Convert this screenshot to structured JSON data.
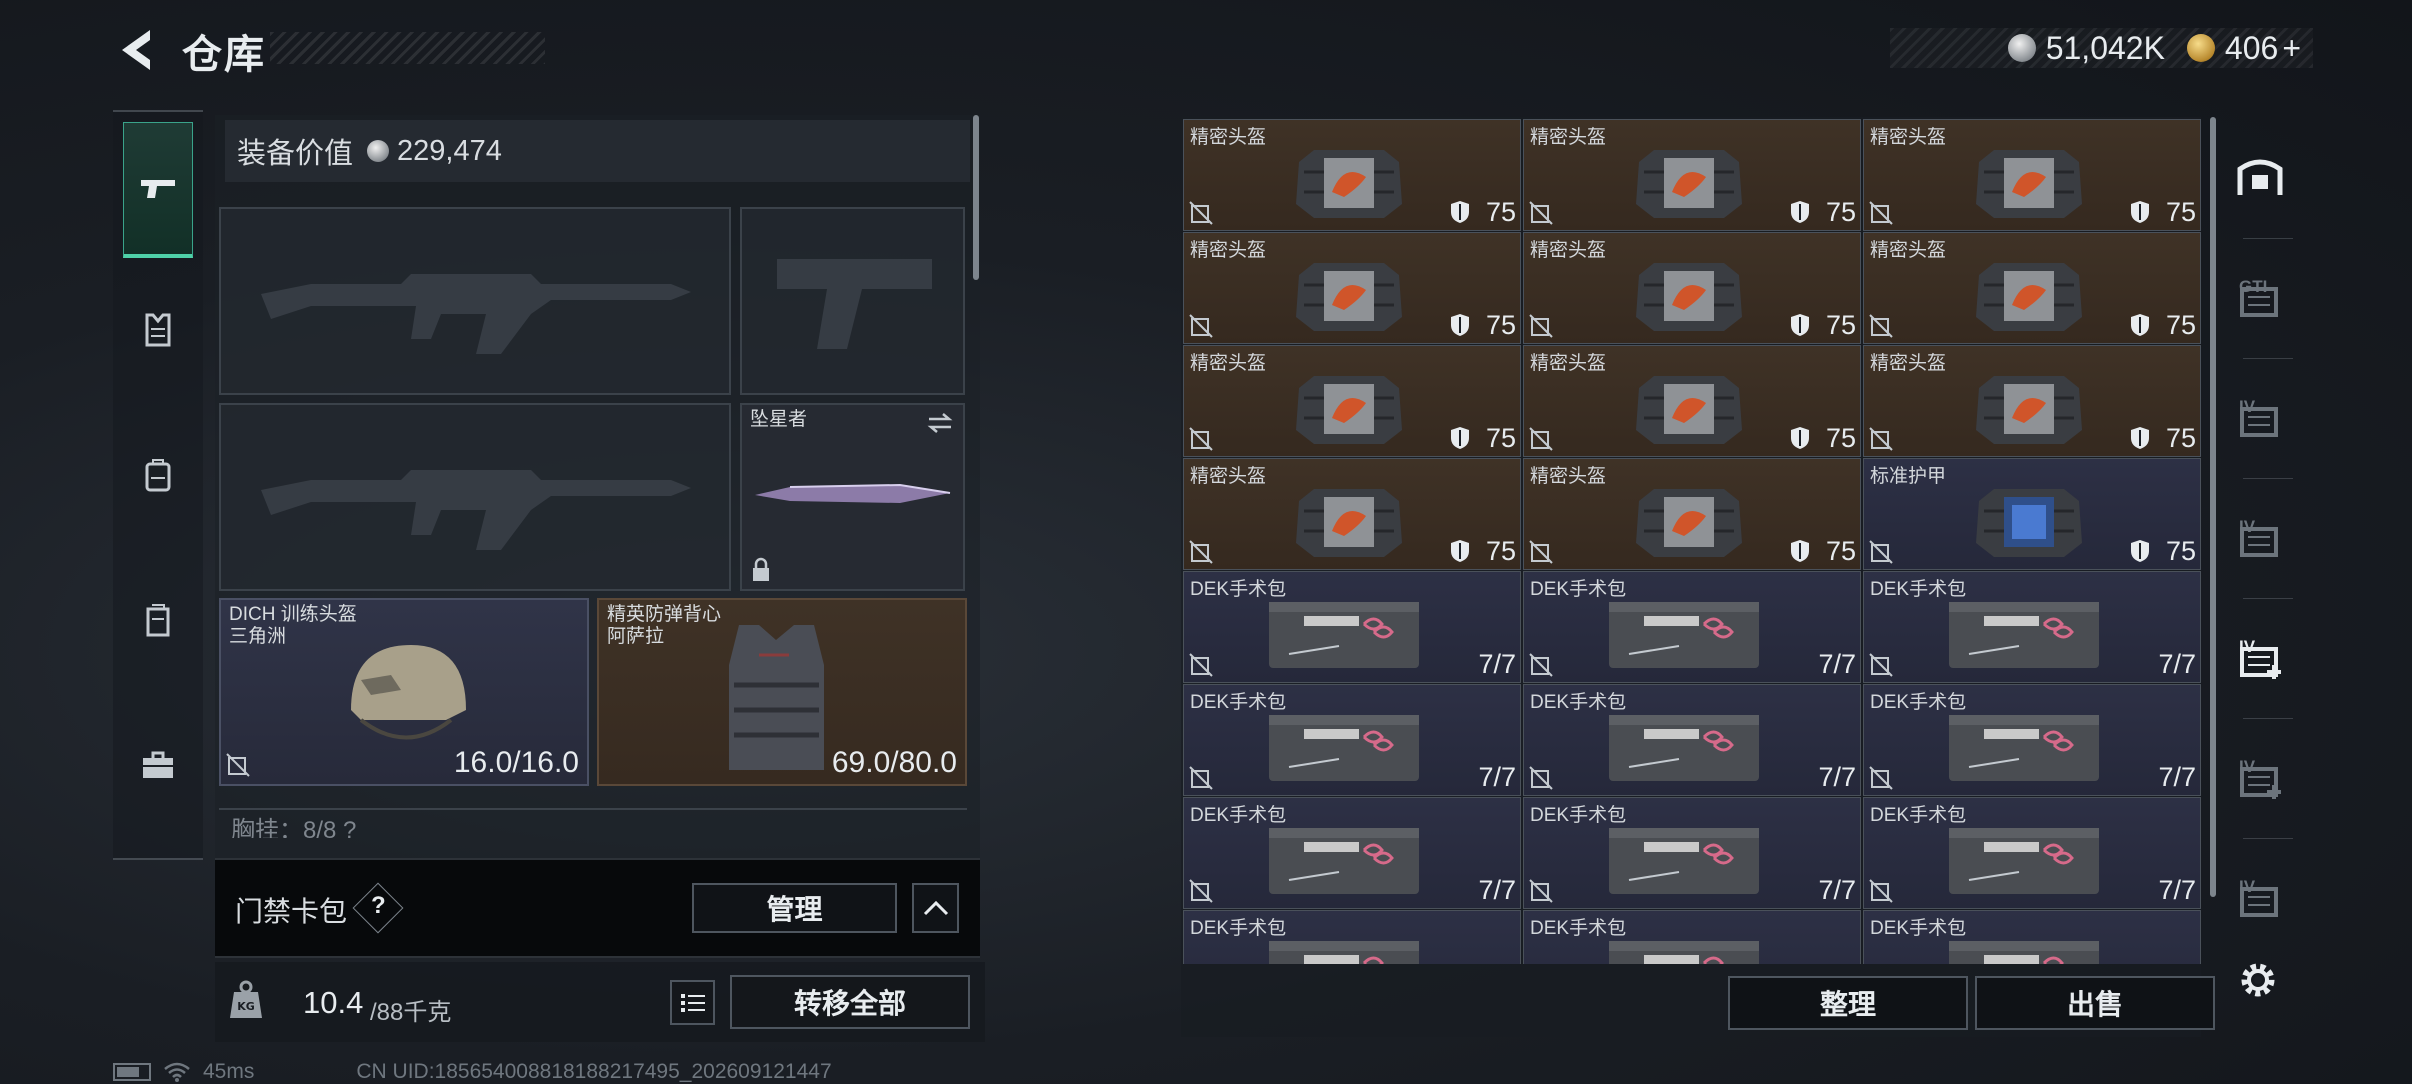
{
  "header": {
    "title": "仓库",
    "currency_silver": "51,042K",
    "currency_gold": "406",
    "currency_gold_add": "+"
  },
  "equipment": {
    "value_label": "装备价值",
    "value": "229,474",
    "melee_label": "坠星者",
    "helmet_name": "DICH 训练头盔",
    "helmet_sub": "三角洲",
    "helmet_durability": "16.0/16.0",
    "armor_name": "精英防弹背心",
    "armor_sub": "阿萨拉",
    "armor_durability": "69.0/80.0",
    "chest_row": "胸挂：8/8  ?"
  },
  "access_card": {
    "label": "门禁卡包",
    "help": "?",
    "manage_label": "管理"
  },
  "weight": {
    "current": "10.4",
    "max": "/88千克",
    "transfer_label": "转移全部"
  },
  "status": {
    "ping": "45ms",
    "uid": "CN UID:185654008818188217495_202609121447"
  },
  "storage": {
    "sort_label": "整理",
    "sell_label": "出售",
    "items": [
      {
        "name": "精密头盔",
        "value": "75",
        "type": "helmet"
      },
      {
        "name": "精密头盔",
        "value": "75",
        "type": "helmet"
      },
      {
        "name": "精密头盔",
        "value": "75",
        "type": "helmet"
      },
      {
        "name": "精密头盔",
        "value": "75",
        "type": "helmet"
      },
      {
        "name": "精密头盔",
        "value": "75",
        "type": "helmet"
      },
      {
        "name": "精密头盔",
        "value": "75",
        "type": "helmet"
      },
      {
        "name": "精密头盔",
        "value": "75",
        "type": "helmet"
      },
      {
        "name": "精密头盔",
        "value": "75",
        "type": "helmet"
      },
      {
        "name": "精密头盔",
        "value": "75",
        "type": "helmet"
      },
      {
        "name": "精密头盔",
        "value": "75",
        "type": "helmet"
      },
      {
        "name": "精密头盔",
        "value": "75",
        "type": "helmet"
      },
      {
        "name": "标准护甲",
        "value": "75",
        "type": "armor"
      },
      {
        "name": "DEK手术包",
        "value": "7/7",
        "type": "medkit"
      },
      {
        "name": "DEK手术包",
        "value": "7/7",
        "type": "medkit"
      },
      {
        "name": "DEK手术包",
        "value": "7/7",
        "type": "medkit"
      },
      {
        "name": "DEK手术包",
        "value": "7/7",
        "type": "medkit"
      },
      {
        "name": "DEK手术包",
        "value": "7/7",
        "type": "medkit"
      },
      {
        "name": "DEK手术包",
        "value": "7/7",
        "type": "medkit"
      },
      {
        "name": "DEK手术包",
        "value": "7/7",
        "type": "medkit"
      },
      {
        "name": "DEK手术包",
        "value": "7/7",
        "type": "medkit"
      },
      {
        "name": "DEK手术包",
        "value": "7/7",
        "type": "medkit"
      },
      {
        "name": "DEK手术包",
        "value": "",
        "type": "medkit"
      },
      {
        "name": "DEK手术包",
        "value": "",
        "type": "medkit"
      },
      {
        "name": "DEK手术包",
        "value": "",
        "type": "medkit"
      }
    ]
  },
  "containers": {
    "tab_labels": [
      "",
      "GTI",
      "IV",
      "IV",
      "IV",
      "IV",
      "IV"
    ]
  },
  "colors": {
    "accent_green": "#4fd1a8",
    "cell_brown": "#3f3226",
    "cell_navy": "#2d3045"
  }
}
